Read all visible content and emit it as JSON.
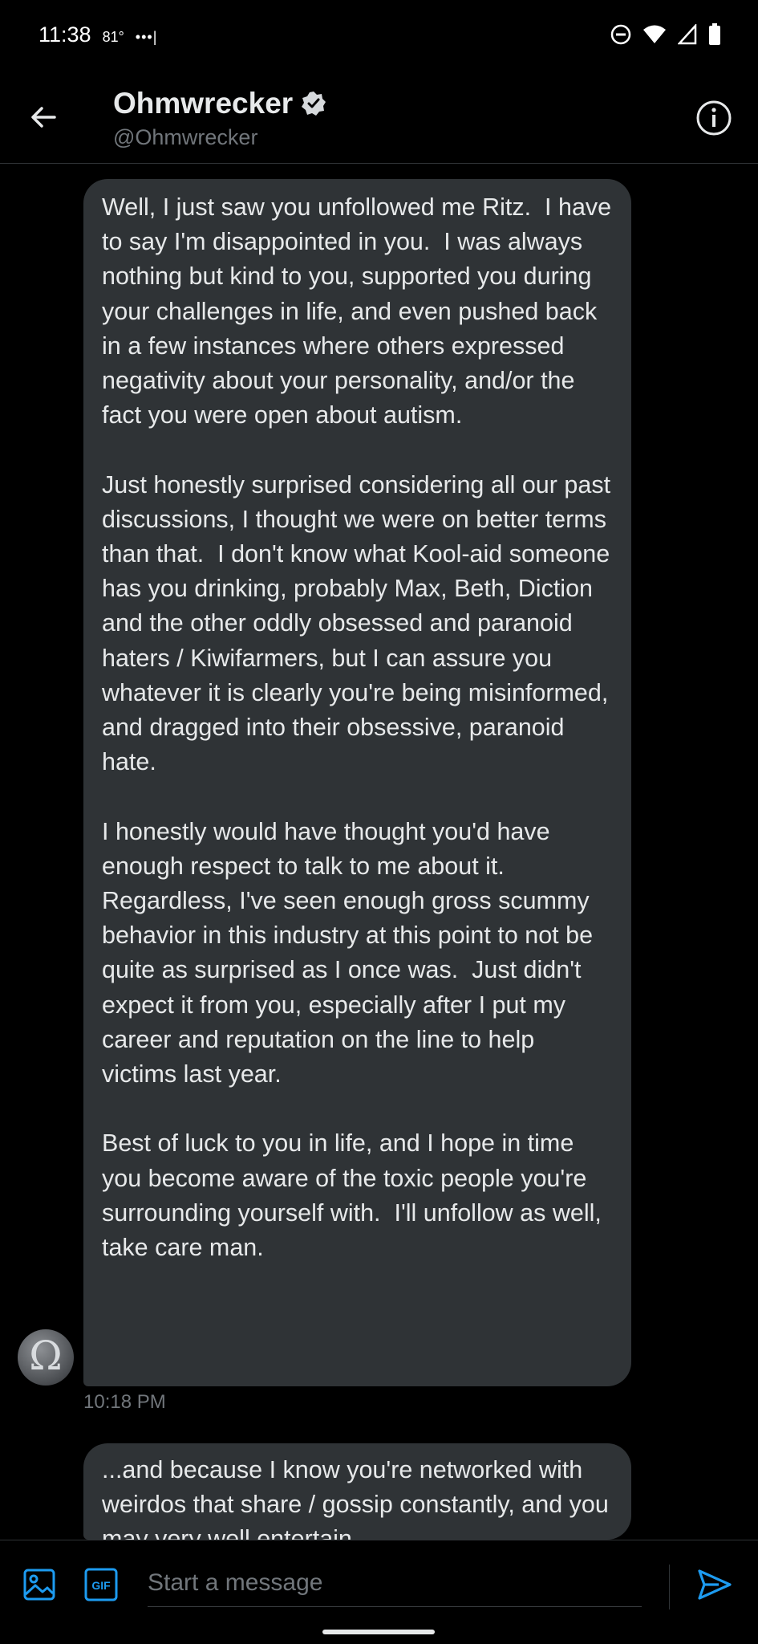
{
  "status_bar": {
    "time": "11:38",
    "temperature": "81°",
    "dots": "•••|"
  },
  "header": {
    "display_name": "Ohmwrecker",
    "handle": "@Ohmwrecker"
  },
  "conversation": {
    "messages": [
      {
        "text": "Well, I just saw you unfollowed me Ritz.  I have to say I'm disappointed in you.  I was always nothing but kind to you, supported you during your challenges in life, and even pushed back in a few instances where others expressed negativity about your personality, and/or the fact you were open about autism.\n\nJust honestly surprised considering all our past discussions, I thought we were on better terms than that.  I don't know what Kool-aid someone has you drinking, probably Max, Beth, Diction and the other oddly obsessed and paranoid haters / Kiwifarmers, but I can assure you whatever it is clearly you're being misinformed, and dragged into their obsessive, paranoid hate.\n\nI honestly would have thought you'd have enough respect to talk to me about it.  Regardless, I've seen enough gross scummy behavior in this industry at this point to not be quite as surprised as I once was.  Just didn't expect it from you, especially after I put my career and reputation on the line to help victims last year.\n\nBest of luck to you in life, and I hope in time you become aware of the toxic people you're surrounding yourself with.  I'll unfollow as well, take care man.",
        "timestamp": "10:18 PM"
      },
      {
        "text": "...and because I know you're networked with weirdos that share / gossip constantly, and you may very well entertain"
      }
    ]
  },
  "composer": {
    "placeholder": "Start a message",
    "gif_label": "GIF"
  },
  "colors": {
    "background": "#000000",
    "bubble": "#2f3336",
    "accent": "#1d9bf0",
    "secondary_text": "#71767b"
  },
  "icons": [
    "back-arrow-icon",
    "verified-badge-icon",
    "info-icon",
    "image-icon",
    "gif-icon",
    "send-icon",
    "do-not-disturb-icon",
    "wifi-icon",
    "signal-icon",
    "battery-icon"
  ]
}
